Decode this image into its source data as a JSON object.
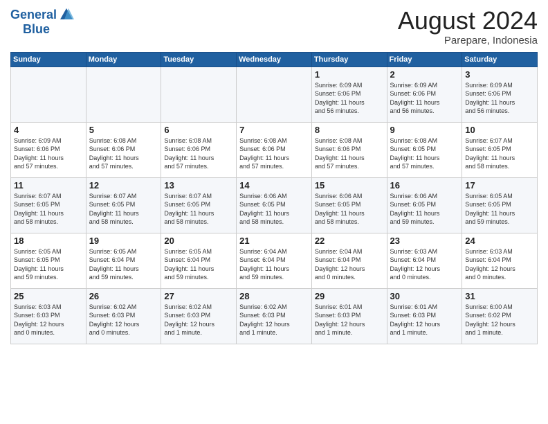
{
  "logo": {
    "general": "General",
    "blue": "Blue"
  },
  "title": {
    "month": "August 2024",
    "location": "Parepare, Indonesia"
  },
  "weekdays": [
    "Sunday",
    "Monday",
    "Tuesday",
    "Wednesday",
    "Thursday",
    "Friday",
    "Saturday"
  ],
  "weeks": [
    [
      {
        "day": "",
        "info": ""
      },
      {
        "day": "",
        "info": ""
      },
      {
        "day": "",
        "info": ""
      },
      {
        "day": "",
        "info": ""
      },
      {
        "day": "1",
        "info": "Sunrise: 6:09 AM\nSunset: 6:06 PM\nDaylight: 11 hours\nand 56 minutes."
      },
      {
        "day": "2",
        "info": "Sunrise: 6:09 AM\nSunset: 6:06 PM\nDaylight: 11 hours\nand 56 minutes."
      },
      {
        "day": "3",
        "info": "Sunrise: 6:09 AM\nSunset: 6:06 PM\nDaylight: 11 hours\nand 56 minutes."
      }
    ],
    [
      {
        "day": "4",
        "info": "Sunrise: 6:09 AM\nSunset: 6:06 PM\nDaylight: 11 hours\nand 57 minutes."
      },
      {
        "day": "5",
        "info": "Sunrise: 6:08 AM\nSunset: 6:06 PM\nDaylight: 11 hours\nand 57 minutes."
      },
      {
        "day": "6",
        "info": "Sunrise: 6:08 AM\nSunset: 6:06 PM\nDaylight: 11 hours\nand 57 minutes."
      },
      {
        "day": "7",
        "info": "Sunrise: 6:08 AM\nSunset: 6:06 PM\nDaylight: 11 hours\nand 57 minutes."
      },
      {
        "day": "8",
        "info": "Sunrise: 6:08 AM\nSunset: 6:06 PM\nDaylight: 11 hours\nand 57 minutes."
      },
      {
        "day": "9",
        "info": "Sunrise: 6:08 AM\nSunset: 6:05 PM\nDaylight: 11 hours\nand 57 minutes."
      },
      {
        "day": "10",
        "info": "Sunrise: 6:07 AM\nSunset: 6:05 PM\nDaylight: 11 hours\nand 58 minutes."
      }
    ],
    [
      {
        "day": "11",
        "info": "Sunrise: 6:07 AM\nSunset: 6:05 PM\nDaylight: 11 hours\nand 58 minutes."
      },
      {
        "day": "12",
        "info": "Sunrise: 6:07 AM\nSunset: 6:05 PM\nDaylight: 11 hours\nand 58 minutes."
      },
      {
        "day": "13",
        "info": "Sunrise: 6:07 AM\nSunset: 6:05 PM\nDaylight: 11 hours\nand 58 minutes."
      },
      {
        "day": "14",
        "info": "Sunrise: 6:06 AM\nSunset: 6:05 PM\nDaylight: 11 hours\nand 58 minutes."
      },
      {
        "day": "15",
        "info": "Sunrise: 6:06 AM\nSunset: 6:05 PM\nDaylight: 11 hours\nand 58 minutes."
      },
      {
        "day": "16",
        "info": "Sunrise: 6:06 AM\nSunset: 6:05 PM\nDaylight: 11 hours\nand 59 minutes."
      },
      {
        "day": "17",
        "info": "Sunrise: 6:05 AM\nSunset: 6:05 PM\nDaylight: 11 hours\nand 59 minutes."
      }
    ],
    [
      {
        "day": "18",
        "info": "Sunrise: 6:05 AM\nSunset: 6:05 PM\nDaylight: 11 hours\nand 59 minutes."
      },
      {
        "day": "19",
        "info": "Sunrise: 6:05 AM\nSunset: 6:04 PM\nDaylight: 11 hours\nand 59 minutes."
      },
      {
        "day": "20",
        "info": "Sunrise: 6:05 AM\nSunset: 6:04 PM\nDaylight: 11 hours\nand 59 minutes."
      },
      {
        "day": "21",
        "info": "Sunrise: 6:04 AM\nSunset: 6:04 PM\nDaylight: 11 hours\nand 59 minutes."
      },
      {
        "day": "22",
        "info": "Sunrise: 6:04 AM\nSunset: 6:04 PM\nDaylight: 12 hours\nand 0 minutes."
      },
      {
        "day": "23",
        "info": "Sunrise: 6:03 AM\nSunset: 6:04 PM\nDaylight: 12 hours\nand 0 minutes."
      },
      {
        "day": "24",
        "info": "Sunrise: 6:03 AM\nSunset: 6:04 PM\nDaylight: 12 hours\nand 0 minutes."
      }
    ],
    [
      {
        "day": "25",
        "info": "Sunrise: 6:03 AM\nSunset: 6:03 PM\nDaylight: 12 hours\nand 0 minutes."
      },
      {
        "day": "26",
        "info": "Sunrise: 6:02 AM\nSunset: 6:03 PM\nDaylight: 12 hours\nand 0 minutes."
      },
      {
        "day": "27",
        "info": "Sunrise: 6:02 AM\nSunset: 6:03 PM\nDaylight: 12 hours\nand 1 minute."
      },
      {
        "day": "28",
        "info": "Sunrise: 6:02 AM\nSunset: 6:03 PM\nDaylight: 12 hours\nand 1 minute."
      },
      {
        "day": "29",
        "info": "Sunrise: 6:01 AM\nSunset: 6:03 PM\nDaylight: 12 hours\nand 1 minute."
      },
      {
        "day": "30",
        "info": "Sunrise: 6:01 AM\nSunset: 6:03 PM\nDaylight: 12 hours\nand 1 minute."
      },
      {
        "day": "31",
        "info": "Sunrise: 6:00 AM\nSunset: 6:02 PM\nDaylight: 12 hours\nand 1 minute."
      }
    ]
  ]
}
